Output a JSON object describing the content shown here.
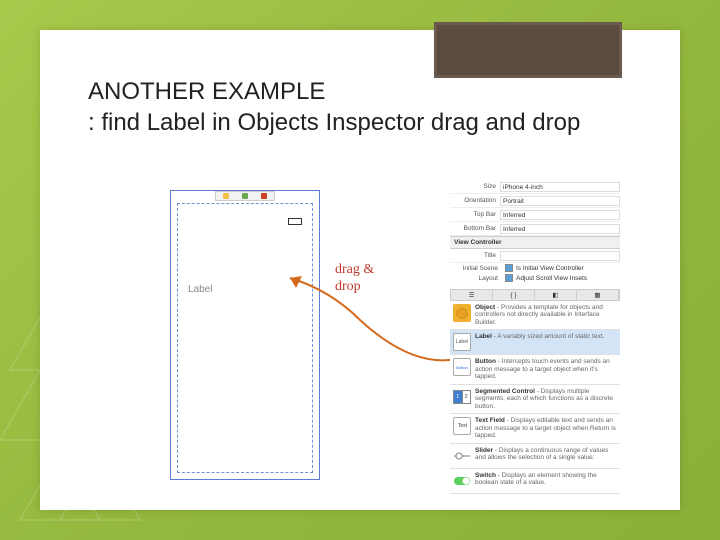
{
  "title_line1": "ANOTHER EXAMPLE",
  "title_line2": ": find Label in Objects Inspector drag and drop",
  "annotation": {
    "line1": "drag &",
    "line2": "drop"
  },
  "phone": {
    "dropped_label": "Label"
  },
  "inspector": {
    "size_label": "Size",
    "size_value": "iPhone 4-inch",
    "orientation_label": "Orientation",
    "orientation_value": "Portrait",
    "topbar_label": "Top Bar",
    "topbar_value": "Inferred",
    "bottombar_label": "Bottom Bar",
    "bottombar_value": "Inferred",
    "section_header": "View Controller",
    "title_label": "Title",
    "title_value": "",
    "initial_scene_label": "Initial Scene",
    "initial_scene_check": "Is Initial View Controller",
    "layout_label": "Layout",
    "layout_check": "Adjust Scroll View Insets"
  },
  "library": {
    "items": [
      {
        "title": "Object",
        "desc": " - Provides a template for objects and controllers not directly available in Interface Builder."
      },
      {
        "title": "Label",
        "desc": " - A variably sized amount of static text."
      },
      {
        "title": "Button",
        "desc": " - Intercepts touch events and sends an action message to a target object when it's tapped."
      },
      {
        "title": "Segmented Control",
        "desc": " - Displays multiple segments, each of which functions as a discrete button."
      },
      {
        "title": "Text Field",
        "desc": " - Displays editable text and sends an action message to a target object when Return is tapped."
      },
      {
        "title": "Slider",
        "desc": " - Displays a continuous range of values and allows the selection of a single value."
      },
      {
        "title": "Switch",
        "desc": " - Displays an element showing the boolean state of a value."
      }
    ],
    "textfield_icon": "Text"
  }
}
